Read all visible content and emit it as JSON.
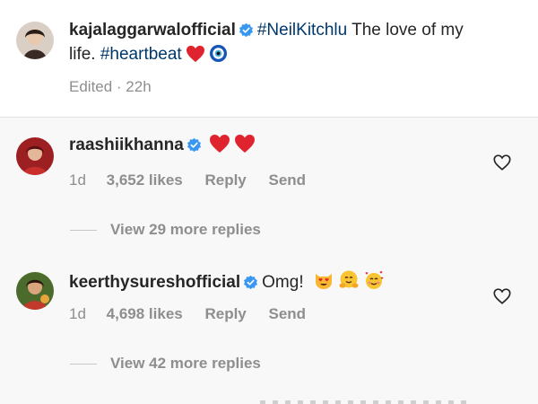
{
  "caption": {
    "username": "kajalaggarwalofficial",
    "hashtag": "#NeilKitchlu",
    "text_line1": "The love of my",
    "text_line2": "life.",
    "hashtag2": "#heartbeat",
    "edited": "Edited · 22h"
  },
  "comments": [
    {
      "username": "raashiikhanna",
      "text": "",
      "time": "1d",
      "likes": "3,652 likes",
      "reply_label": "Reply",
      "send_label": "Send",
      "view_replies": "View 29 more replies"
    },
    {
      "username": "keerthysureshofficial",
      "text": "Omg!",
      "time": "1d",
      "likes": "4,698 likes",
      "reply_label": "Reply",
      "send_label": "Send",
      "view_replies": "View 42 more replies"
    }
  ],
  "colors": {
    "verified_blue": "#3897f0",
    "hashtag_blue": "#00376b",
    "heart_red": "#ed4956",
    "meta_gray": "#8e8e8e"
  },
  "icons": [
    "verified-badge-icon",
    "red-heart-emoji-icon",
    "evil-eye-emoji-icon",
    "heart-like-icon",
    "smiling-cat-heart-eyes-emoji-icon",
    "hugging-face-emoji-icon",
    "smiling-face-hearts-emoji-icon"
  ]
}
